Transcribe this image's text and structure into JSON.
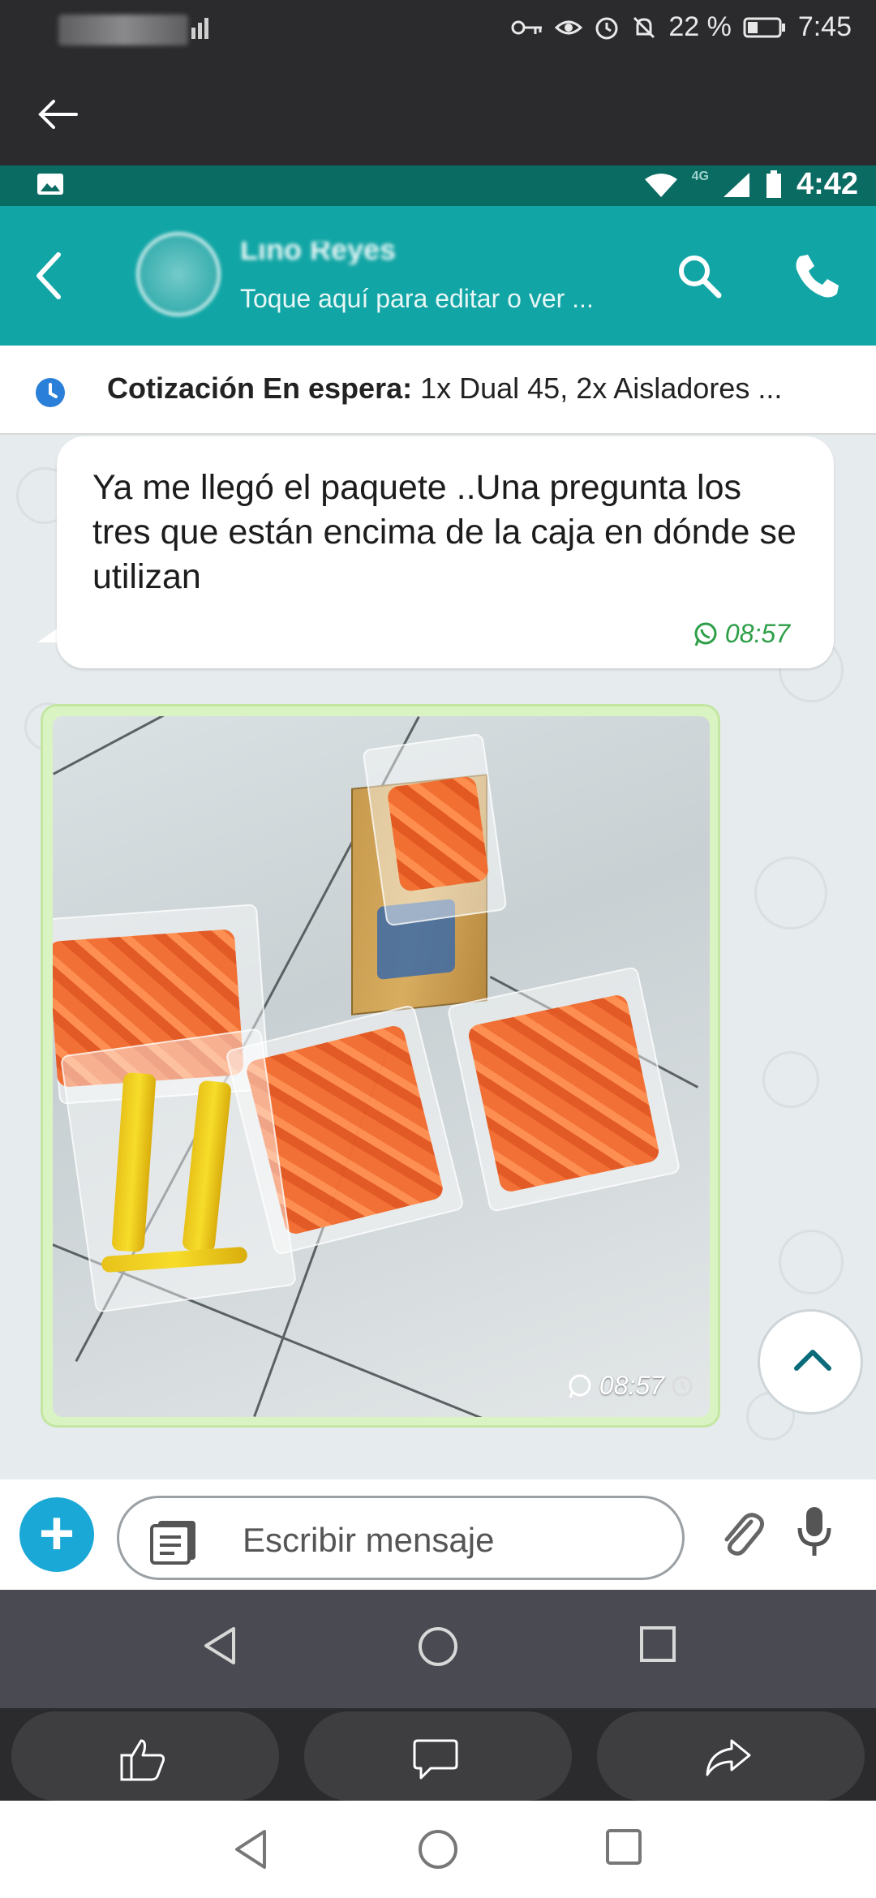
{
  "outer_status": {
    "battery_percent": "22 %",
    "time": "7:45"
  },
  "inner_status": {
    "network": "4G",
    "time": "4:42"
  },
  "appbar": {
    "contact_name": "Lino Reyes",
    "subtitle": "Toque aquí para editar o ver ..."
  },
  "banner": {
    "label": "Cotización En espera:",
    "details": " 1x Dual 45, 2x Aisladores ..."
  },
  "messages": [
    {
      "text": "Ya me llegó  el  paquete ..Una pregunta los tres que están encima de la caja en dónde se utilizan",
      "time": "08:57"
    },
    {
      "type": "image",
      "time": "08:57"
    }
  ],
  "composer": {
    "placeholder": "Escribir mensaje"
  },
  "icons": [
    "back-arrow-icon",
    "search-icon",
    "phone-icon",
    "clock-icon",
    "plus-icon",
    "notes-icon",
    "attach-icon",
    "mic-icon",
    "chevron-up-icon",
    "like-icon",
    "comment-icon",
    "share-icon"
  ],
  "colors": {
    "appbar": "#12a5a5",
    "status_inner": "#0a6b63",
    "accent_blue": "#1aa8d6",
    "time_green": "#2e9e48"
  }
}
